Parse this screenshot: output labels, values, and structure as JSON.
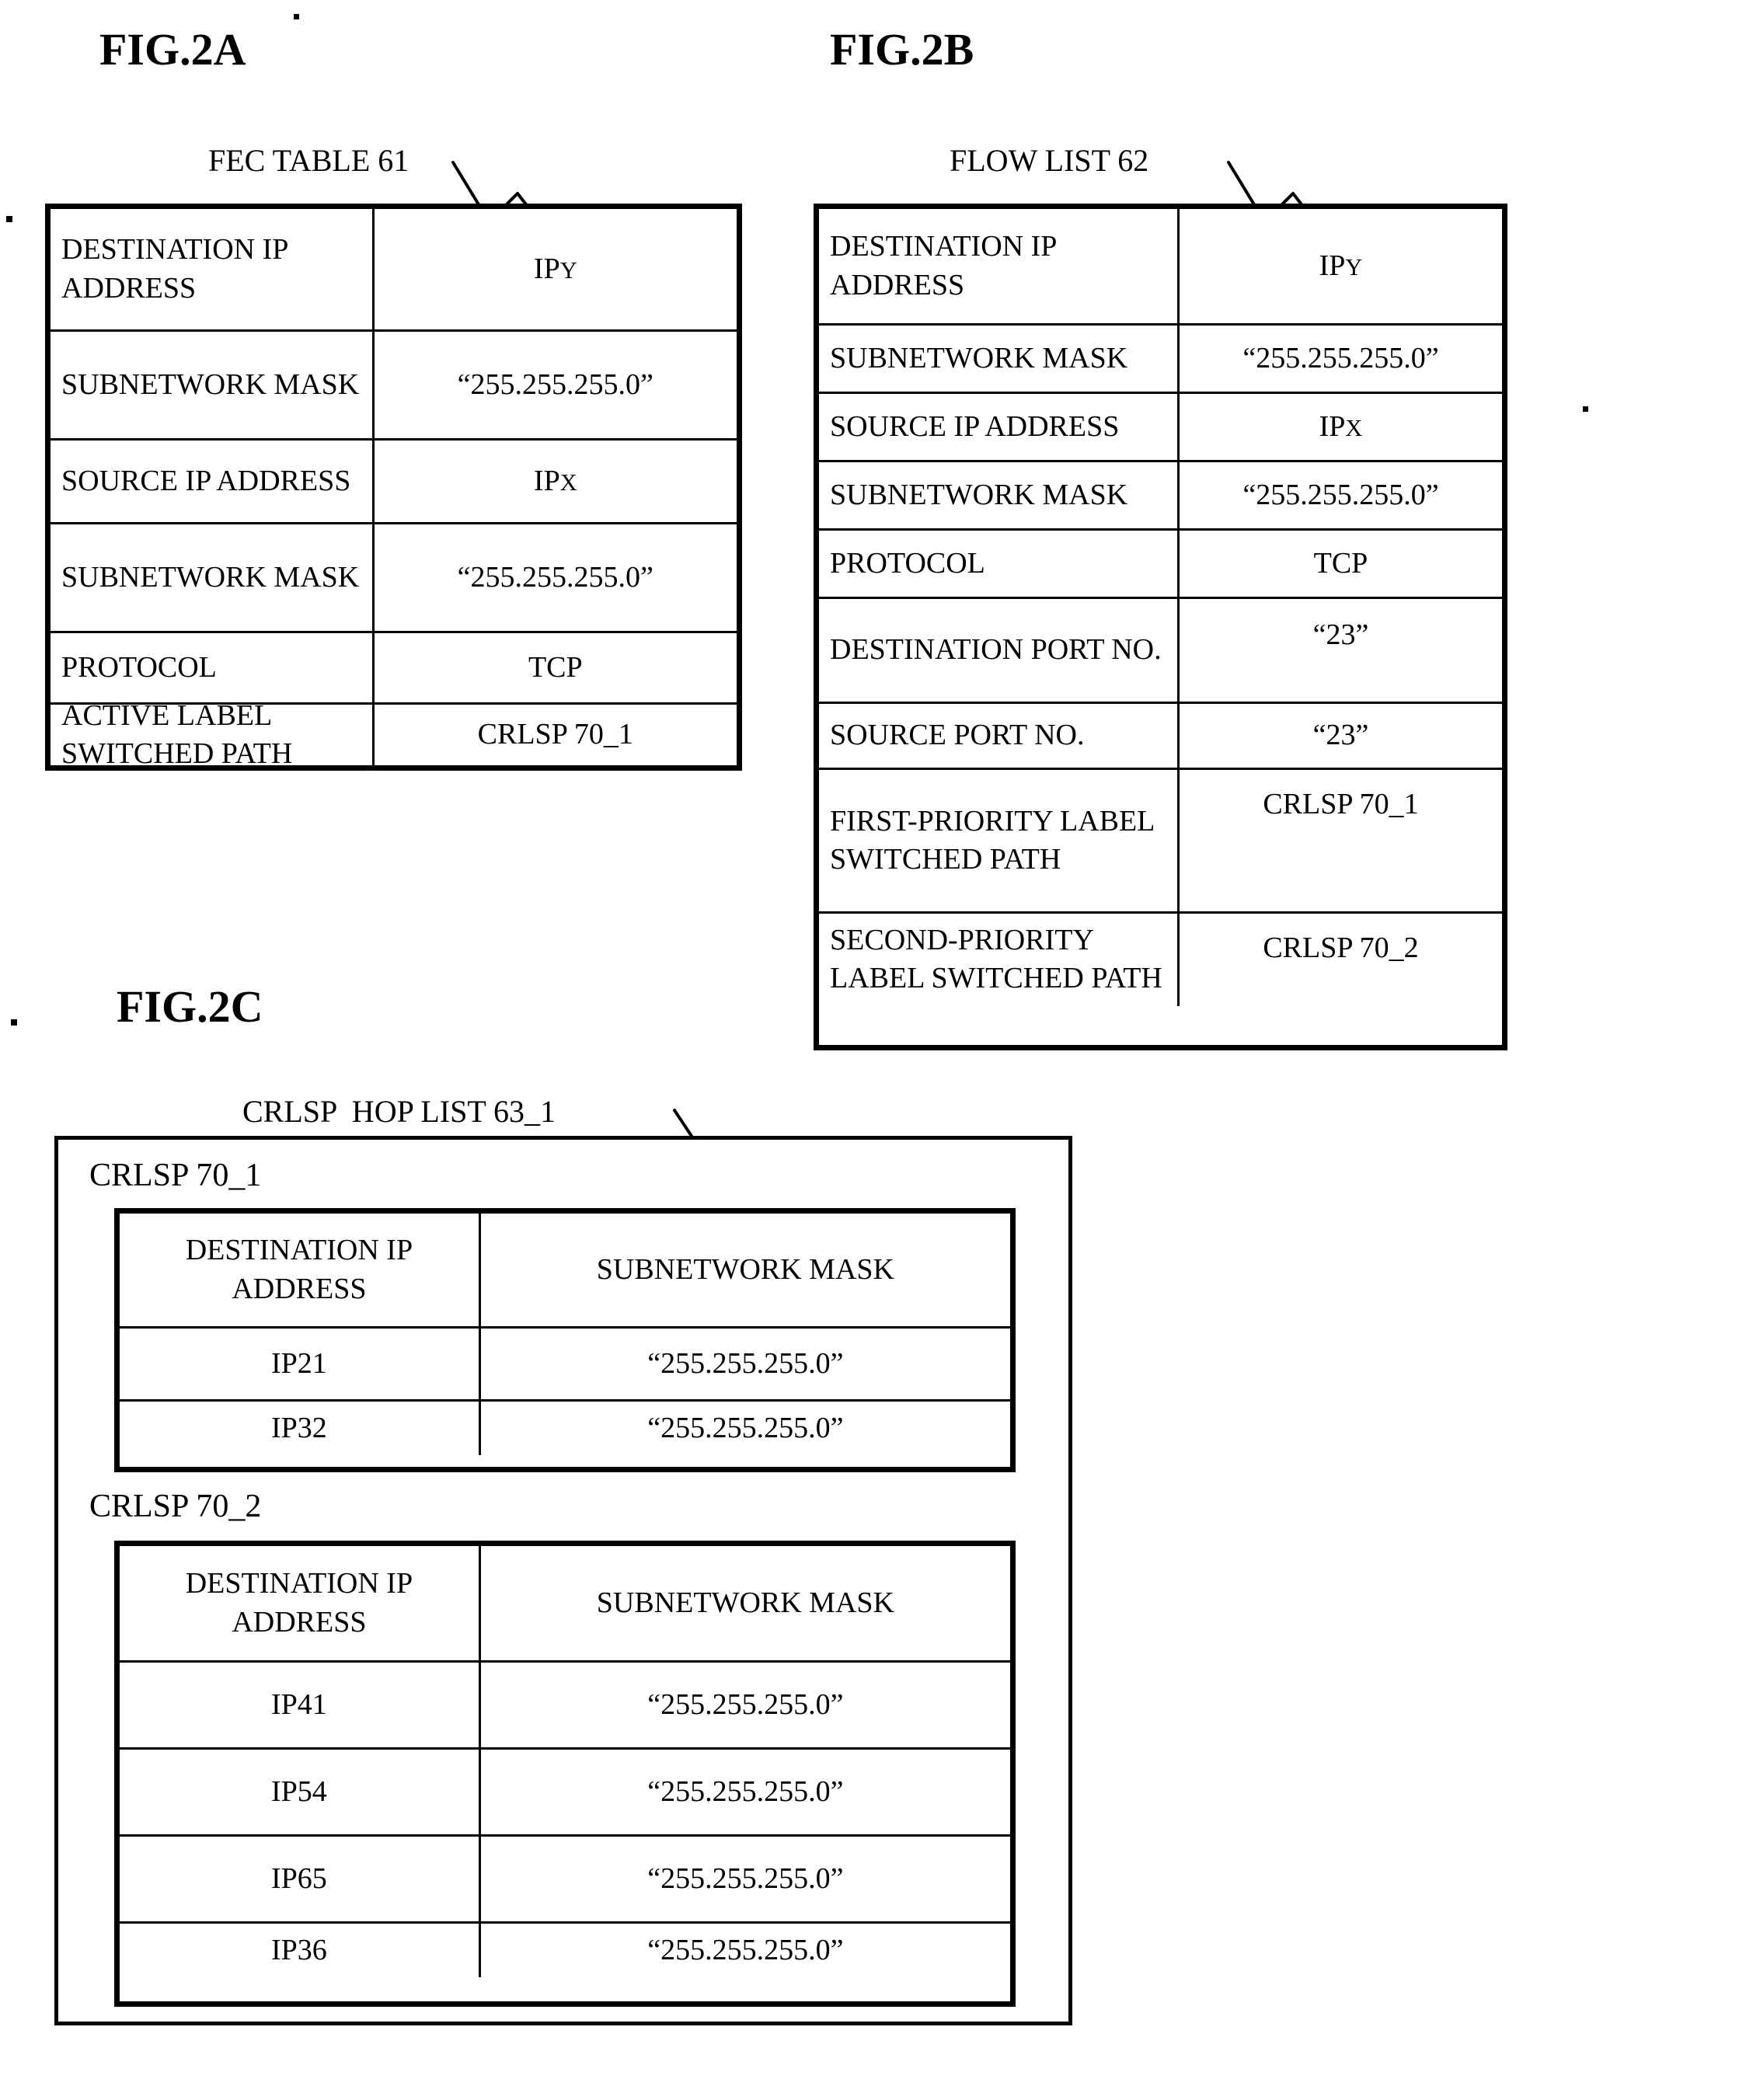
{
  "figures": [
    {
      "id": "fig-2a",
      "title": "FIG.2A",
      "caption": "FEC TABLE 61",
      "rows": [
        {
          "key": "DESTINATION IP ADDRESS",
          "value": "IPY"
        },
        {
          "key": "SUBNETWORK MASK",
          "value": "“255.255.255.0”"
        },
        {
          "key": "SOURCE IP ADDRESS",
          "value": "IPX"
        },
        {
          "key": "SUBNETWORK MASK",
          "value": "“255.255.255.0”"
        },
        {
          "key": "PROTOCOL",
          "value": "TCP"
        },
        {
          "key": "ACTIVE LABEL SWITCHED PATH",
          "value": "CRLSP 70_1"
        }
      ]
    },
    {
      "id": "fig-2b",
      "title": "FIG.2B",
      "caption": "FLOW LIST 62",
      "rows": [
        {
          "key": "DESTINATION IP ADDRESS",
          "value": "IPY"
        },
        {
          "key": "SUBNETWORK MASK",
          "value": "“255.255.255.0”"
        },
        {
          "key": "SOURCE IP ADDRESS",
          "value": "IPX"
        },
        {
          "key": "SUBNETWORK MASK",
          "value": "“255.255.255.0”"
        },
        {
          "key": "PROTOCOL",
          "value": "TCP"
        },
        {
          "key": "DESTINATION PORT NO.",
          "value": "“23”"
        },
        {
          "key": "SOURCE PORT NO.",
          "value": "“23”"
        },
        {
          "key": "FIRST-PRIORITY LABEL SWITCHED PATH",
          "value": "CRLSP 70_1"
        },
        {
          "key": "SECOND-PRIORITY LABEL SWITCHED PATH",
          "value": "CRLSP 70_2"
        }
      ]
    },
    {
      "id": "fig-2c",
      "title": "FIG.2C",
      "caption": "CRLSP  HOP LIST 63_1",
      "groups": [
        {
          "label": "CRLSP 70_1",
          "headers": [
            "DESTINATION IP ADDRESS",
            "SUBNETWORK MASK"
          ],
          "rows": [
            [
              "IP21",
              "“255.255.255.0”"
            ],
            [
              "IP32",
              "“255.255.255.0”"
            ]
          ]
        },
        {
          "label": "CRLSP 70_2",
          "headers": [
            "DESTINATION IP ADDRESS",
            "SUBNETWORK MASK"
          ],
          "rows": [
            [
              "IP41",
              "“255.255.255.0”"
            ],
            [
              "IP54",
              "“255.255.255.0”"
            ],
            [
              "IP65",
              "“255.255.255.0”"
            ],
            [
              "IP36",
              "“255.255.255.0”"
            ]
          ]
        }
      ]
    }
  ]
}
